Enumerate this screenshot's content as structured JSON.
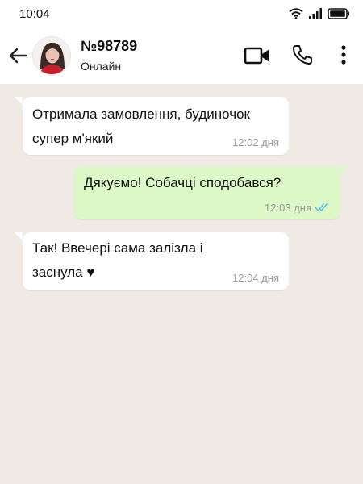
{
  "status_bar": {
    "time": "10:04",
    "icons": [
      "wifi-icon",
      "signal-icon",
      "battery-icon"
    ]
  },
  "header": {
    "back_icon": "arrow-left-icon",
    "contact_name": "№98789",
    "contact_status": "Онлайн",
    "actions": [
      "video-call-icon",
      "phone-icon",
      "more-vertical-icon"
    ]
  },
  "messages": [
    {
      "direction": "incoming",
      "lines": [
        "Отримала замовлення, будиночок",
        "супер м'який"
      ],
      "time": "12:02 дня"
    },
    {
      "direction": "outgoing",
      "lines": [
        "Дякуємо! Собачці сподобався?"
      ],
      "time": "12:03 дня",
      "status": "read"
    },
    {
      "direction": "incoming",
      "lines": [
        "Так! Ввечері сама залізла і",
        "заснула ♥"
      ],
      "time": "12:04 дня"
    }
  ],
  "colors": {
    "chat_background": "#efeae3",
    "incoming_bubble": "#ffffff",
    "outgoing_bubble": "#dcf8c6",
    "read_ticks": "#53bdeb",
    "timestamp": "#9a9a9a"
  }
}
